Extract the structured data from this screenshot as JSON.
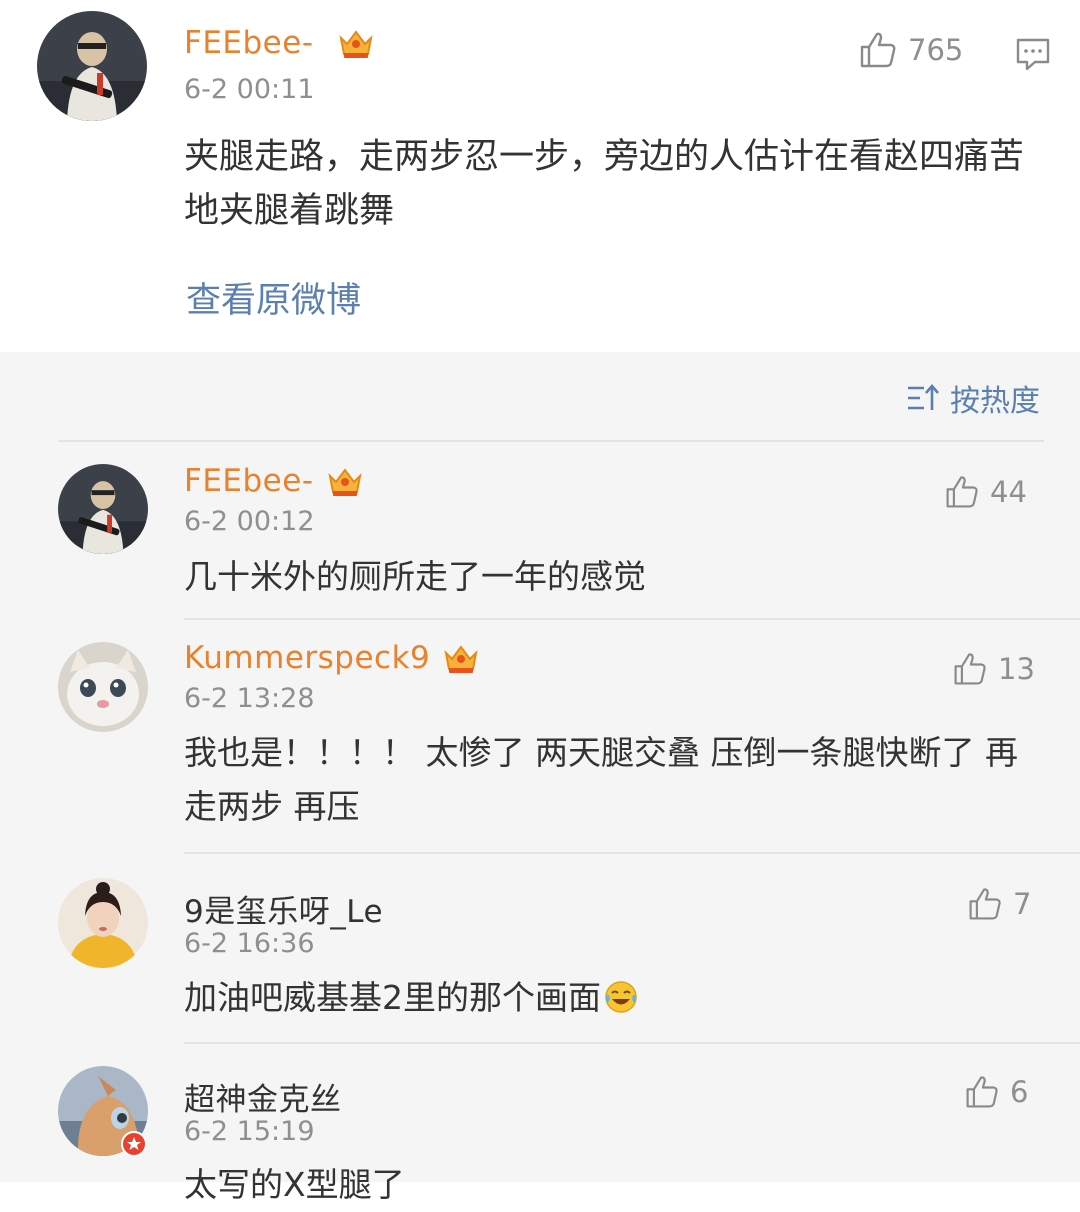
{
  "main_post": {
    "username": "FEEbee-",
    "timestamp": "6-2 00:11",
    "likes": "765",
    "text": "夹腿走路，走两步忍一步，旁边的人估计在看赵四痛苦地夹腿着跳舞",
    "view_original": "查看原微博"
  },
  "sort": {
    "label": "按热度"
  },
  "comments": [
    {
      "username": "FEEbee-",
      "timestamp": "6-2 00:12",
      "likes": "44",
      "text": "几十米外的厕所走了一年的感觉"
    },
    {
      "username": "Kummerspeck9",
      "timestamp": "6-2 13:28",
      "likes": "13",
      "text": "我也是！！！！ 太惨了 两天腿交叠 压倒一条腿快断了 再走两步 再压"
    },
    {
      "username": "9是玺乐呀_Le",
      "timestamp": "6-2 16:36",
      "likes": "7",
      "text": "加油吧威基基2里的那个画面"
    },
    {
      "username": "超神金克丝",
      "timestamp": "6-2 15:19",
      "likes": "6",
      "text": "太写的X型腿了"
    }
  ],
  "colors": {
    "username_vip": "#e8822c",
    "link": "#5a7fb0",
    "muted": "#8f8f8f",
    "text": "#333333",
    "background_comments": "#f5f5f5"
  }
}
